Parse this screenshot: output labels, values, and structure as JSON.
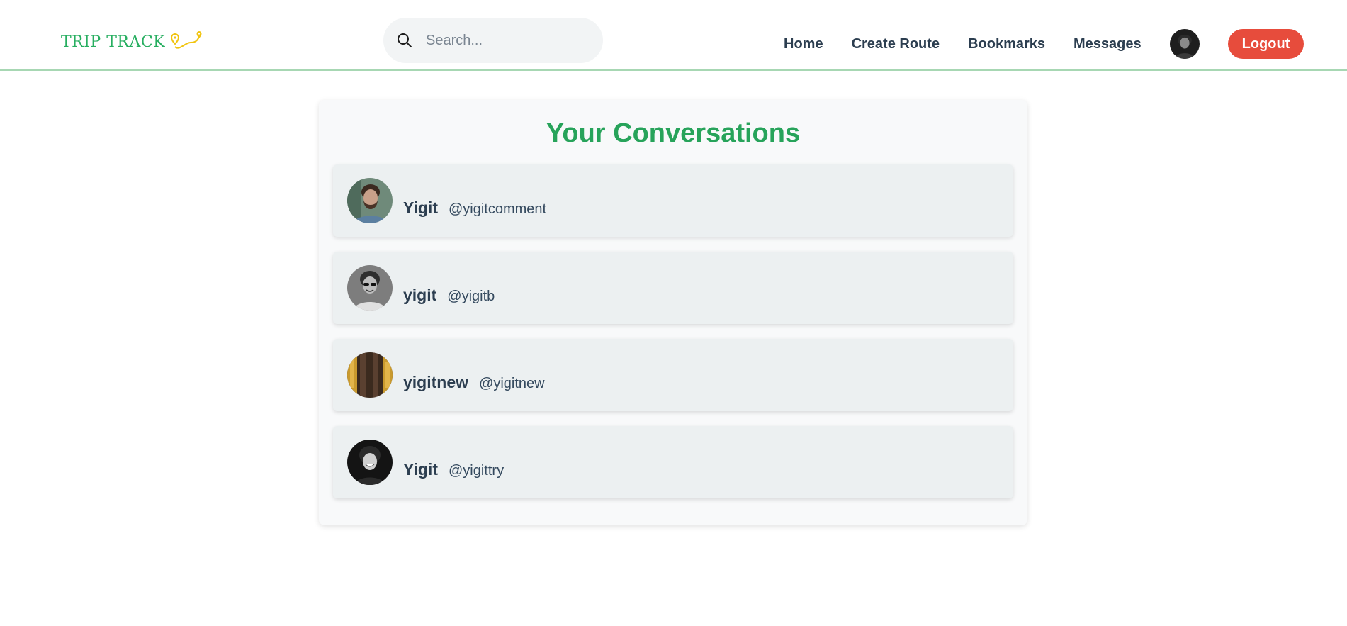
{
  "brand": {
    "name": "TRIP TRACK",
    "logo_icon": "route-pin-icon",
    "color": "#27ae60",
    "accent": "#f1c40f"
  },
  "search": {
    "placeholder": "Search...",
    "value": "",
    "icon": "search-icon"
  },
  "nav": {
    "items": [
      {
        "label": "Home"
      },
      {
        "label": "Create Route"
      },
      {
        "label": "Bookmarks"
      },
      {
        "label": "Messages"
      }
    ],
    "profile_avatar": "user-avatar",
    "logout_label": "Logout",
    "logout_color": "#e74c3c"
  },
  "conversations": {
    "title": "Your Conversations",
    "title_color": "#27a35a",
    "items": [
      {
        "name": "Yigit",
        "handle": "@yigitcomment",
        "avatar": "bearded-man-avatar"
      },
      {
        "name": "yigit",
        "handle": "@yigitb",
        "avatar": "sunglasses-man-avatar"
      },
      {
        "name": "yigitnew",
        "handle": "@yigitnew",
        "avatar": "forest-photo-avatar"
      },
      {
        "name": "Yigit",
        "handle": "@yigittry",
        "avatar": "smiling-man-avatar"
      }
    ]
  }
}
